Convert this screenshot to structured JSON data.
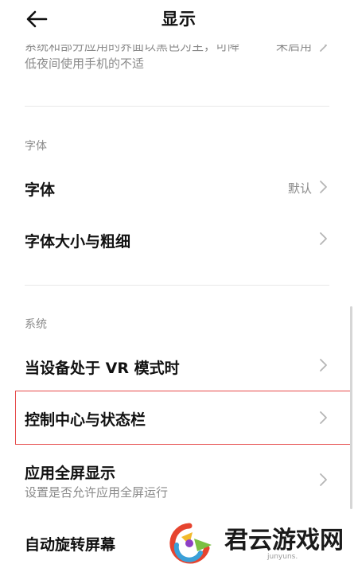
{
  "header": {
    "title": "显示"
  },
  "cut_row": {
    "line1": "系统和部分应用的界面以黑色为主，可降",
    "line2": "低夜间使用手机的不适",
    "value": "未启用"
  },
  "sections": [
    {
      "header": "字体",
      "rows": [
        {
          "label": "字体",
          "value": "默认"
        },
        {
          "label": "字体大小与粗细",
          "value": ""
        }
      ]
    },
    {
      "header": "系统",
      "rows": [
        {
          "label": "当设备处于 VR 模式时",
          "value": ""
        },
        {
          "label": "控制中心与状态栏",
          "value": ""
        },
        {
          "label": "应用全屏显示",
          "subtitle": "设置是否允许应用全屏运行",
          "value": ""
        },
        {
          "label": "自动旋转屏幕",
          "value": ""
        }
      ]
    }
  ],
  "watermark": {
    "text": "君云游戏网",
    "sub": "junyuns."
  },
  "colors": {
    "highlight": "#e64a4a",
    "secondary_text": "#8a8a8a",
    "divider": "#e8e8e8"
  }
}
